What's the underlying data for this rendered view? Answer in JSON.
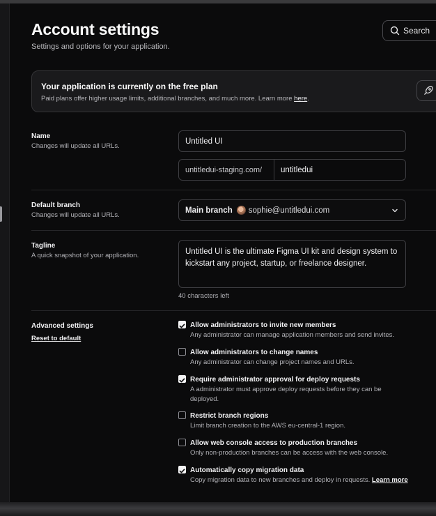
{
  "header": {
    "title": "Account settings",
    "subtitle": "Settings and options for your application.",
    "search_label": "Search"
  },
  "banner": {
    "title": "Your application is currently on the free plan",
    "description": "Paid plans offer higher usage limits, additional branches, and much more. Learn more ",
    "link": "here",
    "suffix": "."
  },
  "name_section": {
    "label": "Name",
    "hint": "Changes will update all URLs.",
    "name_value": "Untitled UI",
    "url_prefix": "untitledui-staging.com/",
    "url_value": "untitledui"
  },
  "branch_section": {
    "label": "Default branch",
    "hint": "Changes will update all URLs.",
    "selected_branch": "Main branch",
    "selected_email": "sophie@untitledui.com"
  },
  "tagline_section": {
    "label": "Tagline",
    "hint": "A quick snapshot of your application.",
    "value": "Untitled UI is the ultimate Figma UI kit and design system to kickstart any project, startup, or freelance designer.",
    "chars_left": "40 characters left"
  },
  "advanced": {
    "label": "Advanced settings",
    "reset_label": "Reset to default",
    "options": [
      {
        "title": "Allow administrators to invite new members",
        "desc": "Any administrator can manage application members and send invites.",
        "checked": true
      },
      {
        "title": "Allow administrators to change names",
        "desc": "Any administrator can change project names and URLs.",
        "checked": false
      },
      {
        "title": "Require administrator approval for deploy requests",
        "desc": "A administrator must approve deploy requests before they can be deployed.",
        "checked": true
      },
      {
        "title": "Restrict branch regions",
        "desc": "Limit branch creation to the AWS eu-central-1 region.",
        "checked": false
      },
      {
        "title": "Allow web console access to production branches",
        "desc": "Only non-production branches can be access with the web console.",
        "checked": false
      },
      {
        "title": "Automatically copy migration data",
        "desc": "Copy migration data to new branches and deploy in requests. ",
        "checked": true,
        "link": "Learn more"
      }
    ]
  },
  "icons": {
    "search": "search-icon",
    "banner_action": "rocket-icon",
    "select": "chevron-down-icon",
    "check": "check-icon"
  },
  "colors": {
    "background": "#0b0b0c",
    "surface": "#1a1a1c",
    "border": "#3e3e42",
    "text": "#f5f5f6",
    "muted": "#b3b3b8"
  }
}
